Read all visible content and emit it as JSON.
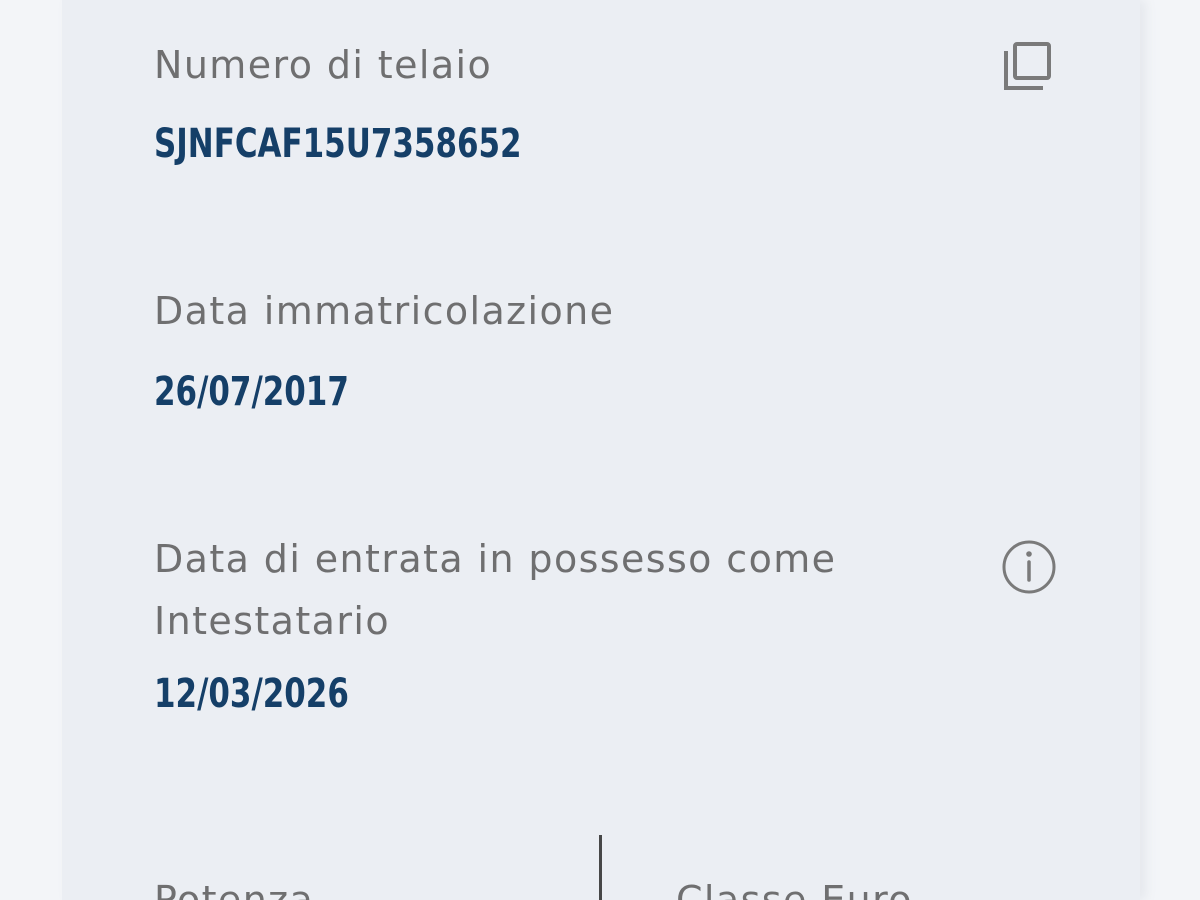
{
  "vehicle_details": {
    "telaio": {
      "label": "Numero di telaio",
      "value": "SJNFCAF15U7358652",
      "action_icon": "copy-icon"
    },
    "immatricolazione": {
      "label": "Data immatricolazione",
      "value": "26/07/2017"
    },
    "possesso": {
      "label": "Data di entrata in possesso come Intestatario",
      "value": "12/03/2026",
      "action_icon": "info-icon"
    },
    "bottom_fields": {
      "potenza_label": "Potenza",
      "classe_euro_label": "Classe Euro"
    }
  },
  "colors": {
    "background": "#f3f5f8",
    "card": "#ebeef3",
    "label": "#6f6f70",
    "value": "#153f68",
    "icon": "#7a7a7a"
  }
}
